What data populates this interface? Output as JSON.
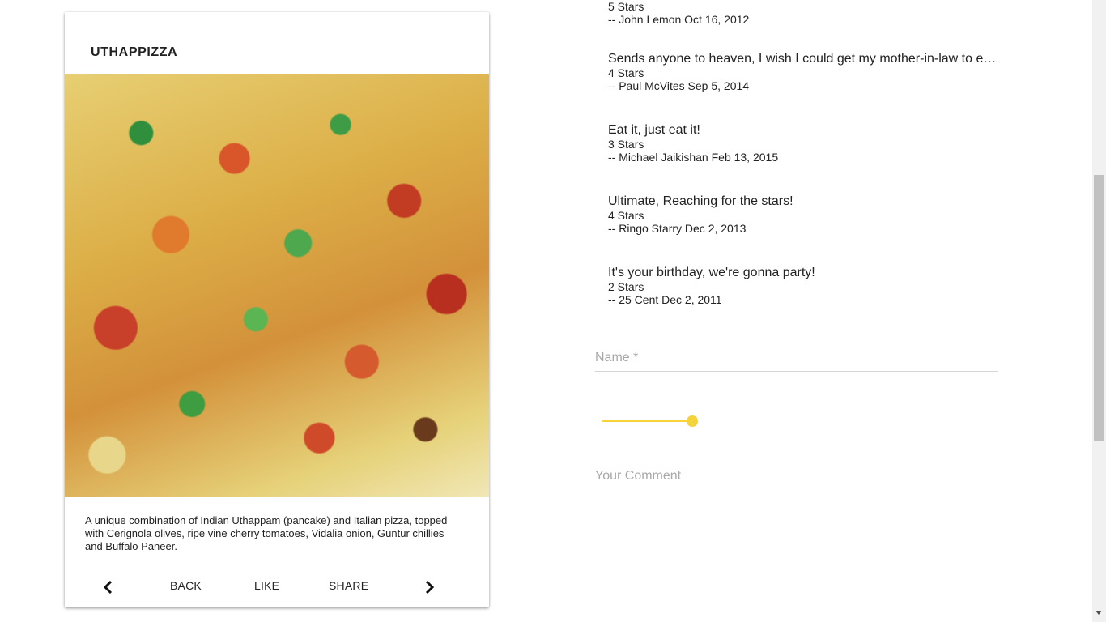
{
  "dish": {
    "name": "UTHAPPIZZA",
    "description": "A unique combination of Indian Uthappam (pancake) and Italian pizza, topped with Cerignola olives, ripe vine cherry tomatoes, Vidalia onion, Guntur chillies and Buffalo Paneer.",
    "actions": {
      "back": "BACK",
      "like": "LIKE",
      "share": "SHARE"
    }
  },
  "comments": [
    {
      "text": "",
      "rating": "5 Stars",
      "meta": "-- John Lemon Oct 16, 2012"
    },
    {
      "text": "Sends anyone to heaven, I wish I could get my mother-in-law to eat it!",
      "rating": "4 Stars",
      "meta": "-- Paul McVites Sep 5, 2014"
    },
    {
      "text": "Eat it, just eat it!",
      "rating": "3 Stars",
      "meta": "-- Michael Jaikishan Feb 13, 2015"
    },
    {
      "text": "Ultimate, Reaching for the stars!",
      "rating": "4 Stars",
      "meta": "-- Ringo Starry Dec 2, 2013"
    },
    {
      "text": "It's your birthday, we're gonna party!",
      "rating": "2 Stars",
      "meta": "-- 25 Cent Dec 2, 2011"
    }
  ],
  "form": {
    "name_label": "Name *",
    "comment_label": "Your Comment",
    "rating": {
      "value": 5,
      "min": 1,
      "max": 5
    }
  },
  "colors": {
    "accent": "#f5d33b",
    "placeholder": "#a8a8a8"
  },
  "icons": {
    "prev": "chevron-left-icon",
    "next": "chevron-right-icon"
  }
}
